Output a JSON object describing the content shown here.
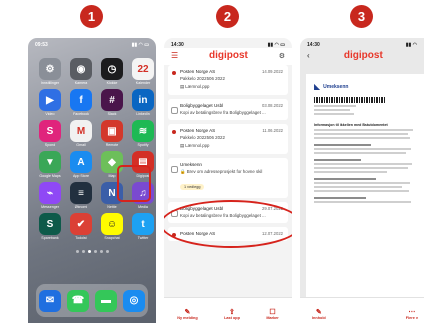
{
  "steps": [
    "1",
    "2",
    "3"
  ],
  "phone1": {
    "status_time": "09:53",
    "status_icons": "▮▮ ◠ ▭",
    "apps": [
      {
        "label": "Innstillinger",
        "glyph": "⚙",
        "color": "#8a8f98",
        "icon": "settings-icon"
      },
      {
        "label": "Kamera",
        "glyph": "◉",
        "color": "#5a5d63",
        "icon": "camera-icon"
      },
      {
        "label": "Klokke",
        "glyph": "◷",
        "color": "#1c1c1e",
        "icon": "clock-icon"
      },
      {
        "label": "Kalender",
        "glyph": "22",
        "color": "#f4f4f4",
        "icon": "calendar-icon"
      },
      {
        "label": "Video",
        "glyph": "▶",
        "color": "#2f6fe4",
        "icon": "video-icon"
      },
      {
        "label": "Facebook",
        "glyph": "f",
        "color": "#1877f2",
        "icon": "facebook-icon"
      },
      {
        "label": "Slack",
        "glyph": "#",
        "color": "#4a154b",
        "icon": "slack-icon"
      },
      {
        "label": "LinkedIn",
        "glyph": "in",
        "color": "#0a66c2",
        "icon": "linkedin-icon"
      },
      {
        "label": "Spond",
        "glyph": "S",
        "color": "#e0247c",
        "icon": "spond-icon"
      },
      {
        "label": "Gmail",
        "glyph": "M",
        "color": "#f1f1f1",
        "icon": "gmail-icon"
      },
      {
        "label": "Remote",
        "glyph": "▣",
        "color": "#d3382b",
        "icon": "remote-icon"
      },
      {
        "label": "Spotify",
        "glyph": "≋",
        "color": "#1db954",
        "icon": "spotify-icon"
      },
      {
        "label": "Google Maps",
        "glyph": "▼",
        "color": "#3aa757",
        "icon": "maps-icon"
      },
      {
        "label": "App Store",
        "glyph": "A",
        "color": "#1a8cf0",
        "icon": "app-store-icon"
      },
      {
        "label": "Map",
        "glyph": "◆",
        "color": "#6dbf5a",
        "icon": "map-icon"
      },
      {
        "label": "Digipost",
        "glyph": "▤",
        "color": "#d32f26",
        "icon": "digipost-icon"
      },
      {
        "label": "Messenger",
        "glyph": "⌁",
        "color": "#8f48f5",
        "icon": "messenger-icon"
      },
      {
        "label": "Øknomi",
        "glyph": "≡",
        "color": "#22303f",
        "icon": "economy-icon"
      },
      {
        "label": "Nettie",
        "glyph": "N",
        "color": "#3b5ea8",
        "icon": "nettie-icon"
      },
      {
        "label": "Media",
        "glyph": "♫",
        "color": "#7a4ad0",
        "icon": "media-icon"
      },
      {
        "label": "Sparebank",
        "glyph": "S",
        "color": "#0e5a4a",
        "icon": "bank-icon"
      },
      {
        "label": "Todoist",
        "glyph": "✔",
        "color": "#db4035",
        "icon": "todoist-icon"
      },
      {
        "label": "Snapchat",
        "glyph": "☺",
        "color": "#fffc00",
        "icon": "snapchat-icon"
      },
      {
        "label": "Twitter",
        "glyph": "t",
        "color": "#1da1f2",
        "icon": "twitter-icon"
      }
    ],
    "dock": [
      {
        "glyph": "✉",
        "color": "#1f6fe0",
        "icon": "outlook-icon"
      },
      {
        "glyph": "☎",
        "color": "#34c759",
        "icon": "phone-icon"
      },
      {
        "glyph": "▬",
        "color": "#34c759",
        "icon": "messages-icon"
      },
      {
        "glyph": "◎",
        "color": "#1a8cf0",
        "icon": "safari-icon"
      }
    ]
  },
  "phone2": {
    "status_time": "14:30",
    "logo": "digipost",
    "items": [
      {
        "sender": "Posten Norge AS",
        "date": "14.09.2022",
        "subject": "Pakkelo 2022506 2022",
        "attachment": "Lærnnol.ppp",
        "unread": true
      },
      {
        "sender": "Boligbyggelaget Usbl",
        "date": "03.08.2022",
        "subject": "Kopi av betalingsbrev fra Boligbyggelaget ...",
        "unread": false
      },
      {
        "sender": "Posten Norge AS",
        "date": "11.06.2022",
        "subject": "Pakkelo 2022506 2022",
        "attachment": "Lærnnol.ppp",
        "unread": true
      },
      {
        "sender": "Umeksenn",
        "date": "",
        "subject": "Brev om adresseprosjekt for hovne skil",
        "pill": "1 vedlegg",
        "unread": false
      },
      {
        "sender": "Boligbyggelaget Usbl",
        "date": "29.07.2022",
        "subject": "Kopi av betalingsbrev fra Boligbyggelaget ...",
        "unread": false
      },
      {
        "sender": "Posten Norge AS",
        "date": "12.07.2022",
        "subject": "",
        "unread": true
      }
    ],
    "tabs": [
      "Ny melding",
      "Last opp",
      "Marker"
    ]
  },
  "phone3": {
    "status_time": "14:30",
    "logo": "digipost",
    "sender": "Umeksenn",
    "heading": "Informasjon til ikkelien med Bstutdomentet",
    "tabs": [
      "Innhold",
      "Flere v"
    ]
  }
}
